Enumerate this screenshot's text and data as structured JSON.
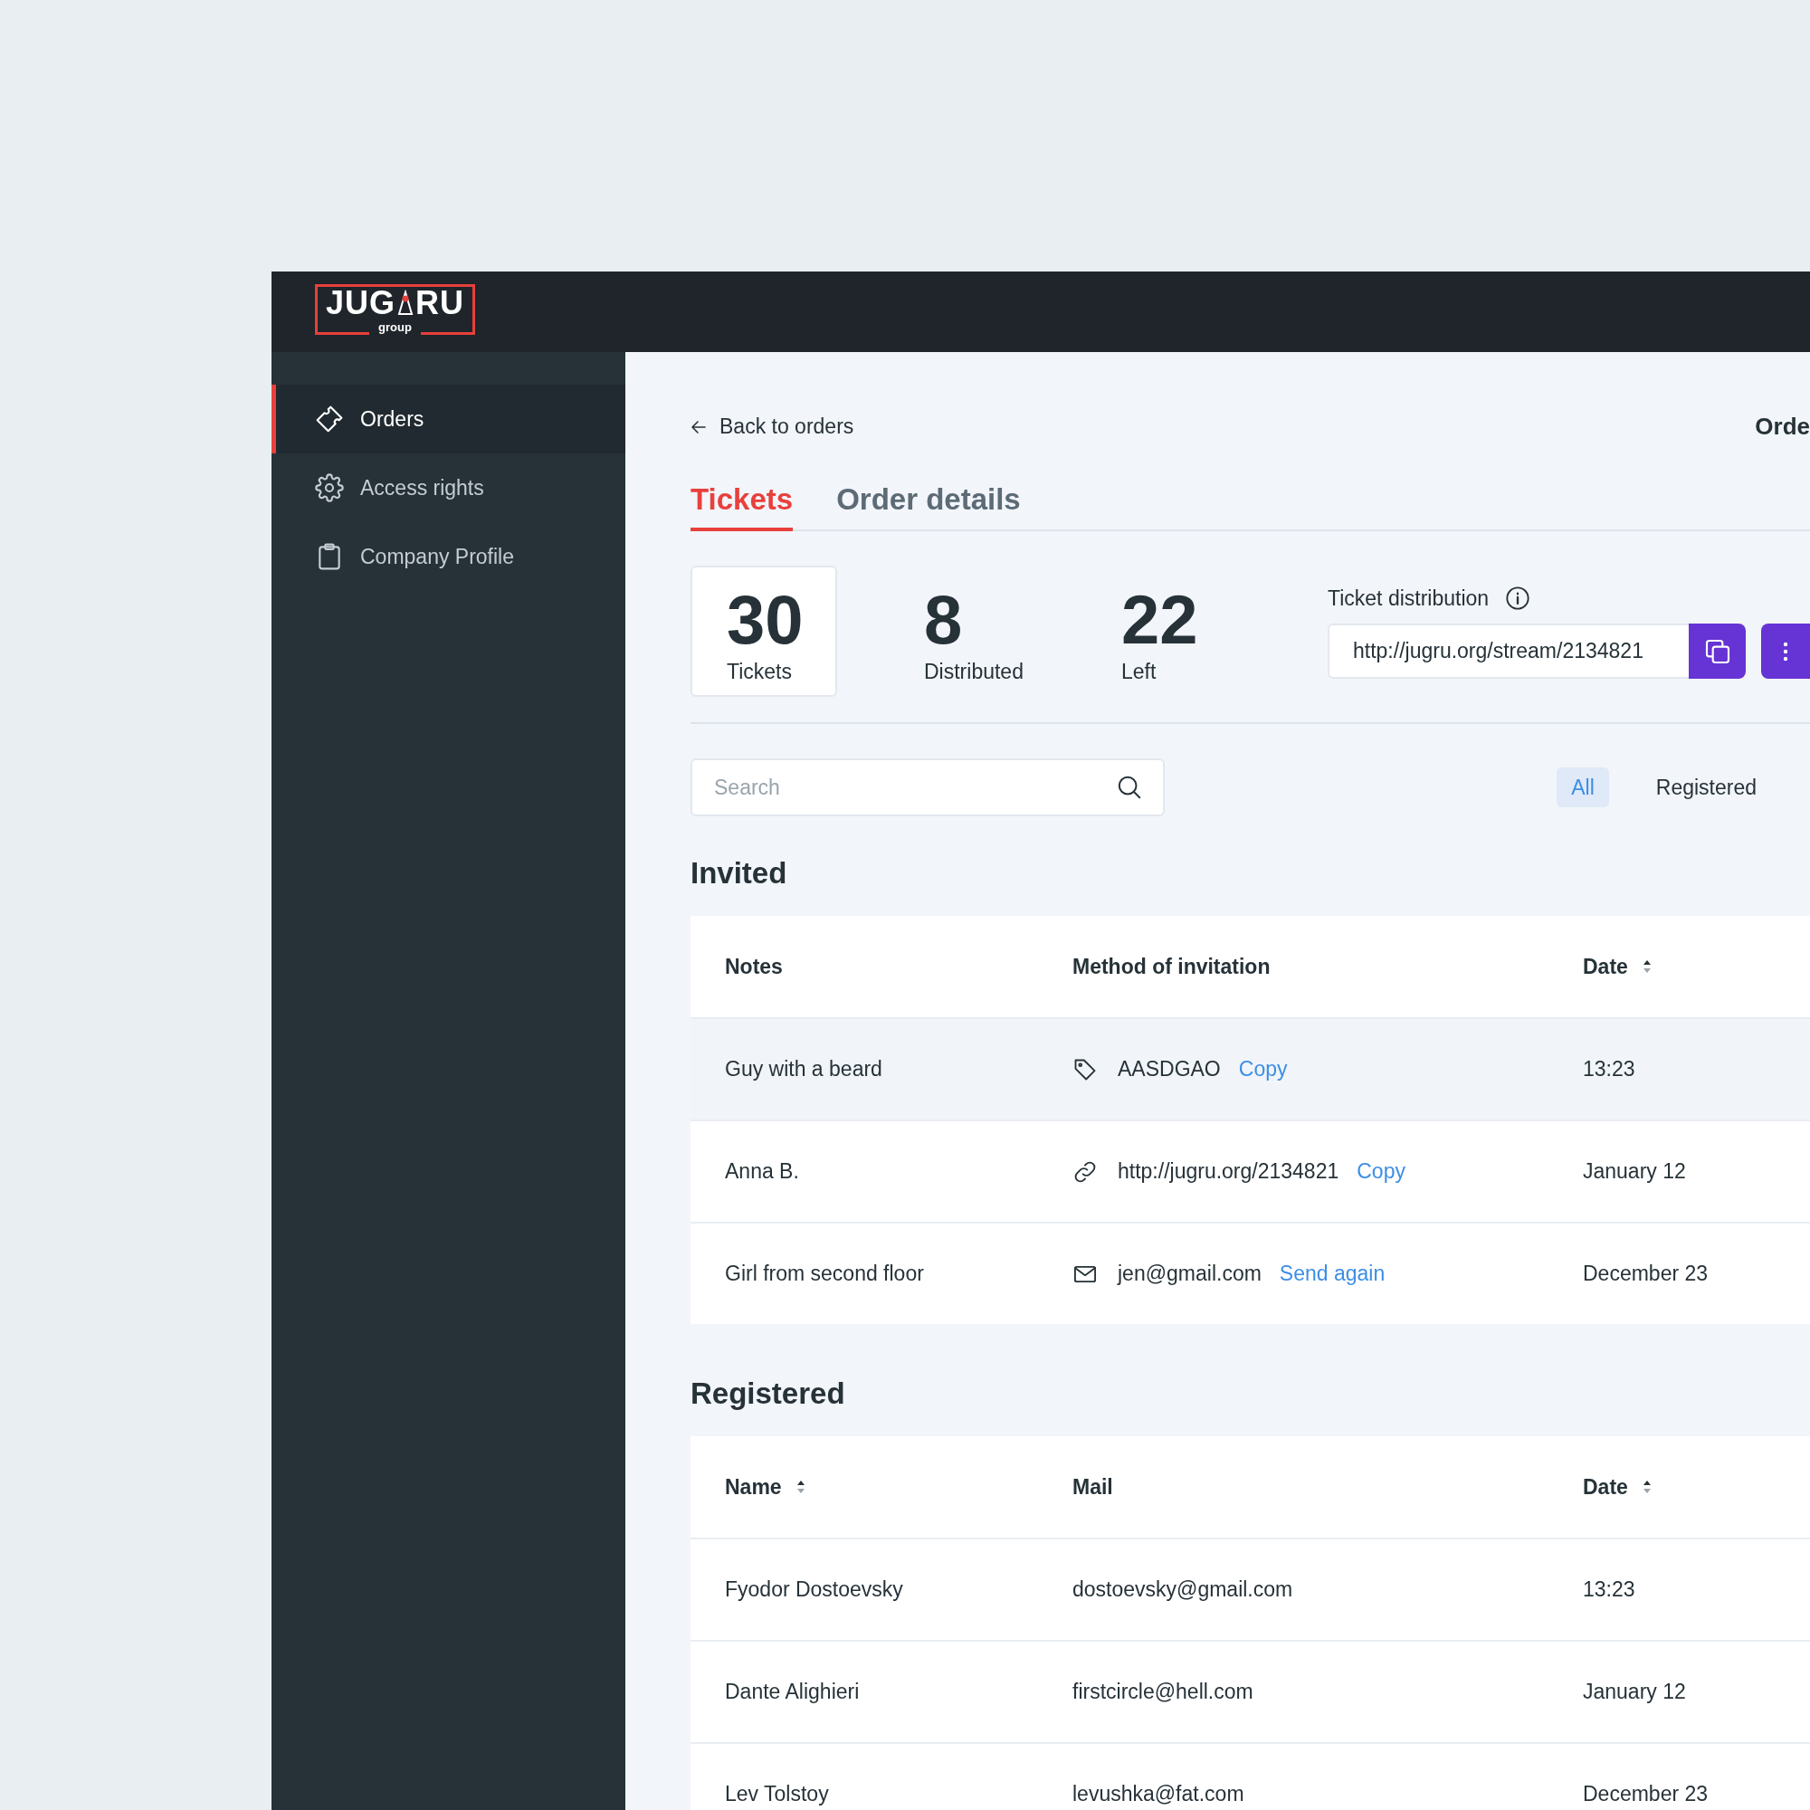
{
  "logo": {
    "left": "JUG",
    "right": "RU",
    "sub": "group"
  },
  "sidebar": {
    "items": [
      {
        "label": "Orders",
        "selected": true
      },
      {
        "label": "Access rights",
        "selected": false
      },
      {
        "label": "Company Profile",
        "selected": false
      }
    ]
  },
  "back_link": "Back to orders",
  "page_title": "Orde",
  "tabs": [
    {
      "label": "Tickets",
      "selected": true
    },
    {
      "label": "Order details",
      "selected": false
    }
  ],
  "stats": [
    {
      "value": "30",
      "label": "Tickets",
      "selected": true
    },
    {
      "value": "8",
      "label": "Distributed",
      "selected": false
    },
    {
      "value": "22",
      "label": "Left",
      "selected": false
    }
  ],
  "distribution": {
    "label": "Ticket distribution",
    "value": "http://jugru.org/stream/2134821"
  },
  "search": {
    "placeholder": "Search"
  },
  "filters": [
    {
      "label": "All",
      "selected": true
    },
    {
      "label": "Registered",
      "selected": false
    }
  ],
  "invited": {
    "title": "Invited",
    "columns": [
      {
        "label": "Notes",
        "sortable": false
      },
      {
        "label": "Method of invitation",
        "sortable": false
      },
      {
        "label": "Date",
        "sortable": true
      }
    ],
    "rows": [
      {
        "note": "Guy with a beard",
        "kind": "code",
        "value": "AASDGAO",
        "action": "Copy",
        "date": "13:23",
        "selected": true
      },
      {
        "note": "Anna B.",
        "kind": "link",
        "value": "http://jugru.org/2134821",
        "action": "Copy",
        "date": "January 12",
        "selected": false
      },
      {
        "note": "Girl from second floor",
        "kind": "mail",
        "value": "jen@gmail.com",
        "action": "Send again",
        "date": "December 23",
        "selected": false
      }
    ]
  },
  "registered": {
    "title": "Registered",
    "columns": [
      {
        "label": "Name",
        "sortable": true
      },
      {
        "label": "Mail",
        "sortable": false
      },
      {
        "label": "Date",
        "sortable": true
      }
    ],
    "rows": [
      {
        "name": "Fyodor Dostoevsky",
        "mail": "dostoevsky@gmail.com",
        "date": "13:23"
      },
      {
        "name": "Dante Alighieri",
        "mail": "firstcircle@hell.com",
        "date": "January 12"
      },
      {
        "name": "Lev Tolstoy",
        "mail": "levushka@fat.com",
        "date": "December 23"
      }
    ]
  }
}
